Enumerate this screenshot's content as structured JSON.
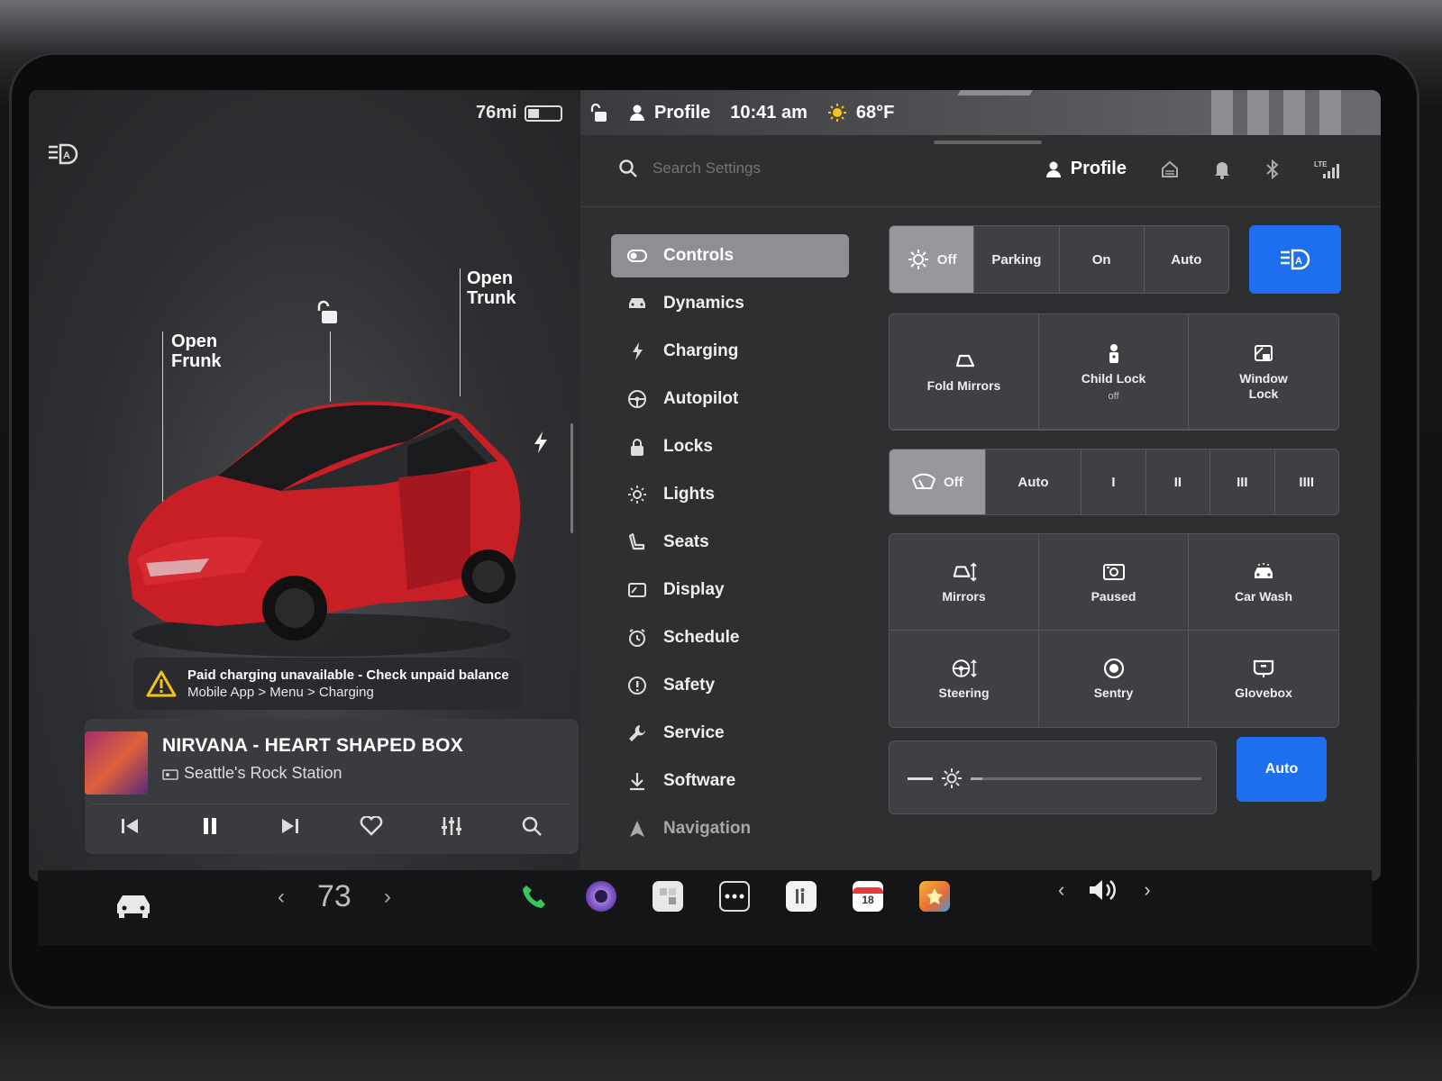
{
  "status": {
    "range": "76mi",
    "profile_label": "Profile",
    "time": "10:41 am",
    "temperature": "68°F"
  },
  "car_view": {
    "open_frunk_label": [
      "Open",
      "Frunk"
    ],
    "open_trunk_label": [
      "Open",
      "Trunk"
    ],
    "car_color": "#d2232a"
  },
  "alert": {
    "line1": "Paid charging unavailable - Check unpaid balance",
    "line2": "Mobile App > Menu > Charging"
  },
  "media": {
    "title": "NIRVANA - HEART SHAPED BOX",
    "station": "Seattle's Rock Station"
  },
  "settings": {
    "search_placeholder": "Search Settings",
    "profile_label": "Profile",
    "nav": [
      {
        "label": "Controls",
        "icon": "toggle-icon"
      },
      {
        "label": "Dynamics",
        "icon": "car-icon"
      },
      {
        "label": "Charging",
        "icon": "bolt-icon"
      },
      {
        "label": "Autopilot",
        "icon": "steering-wheel-icon"
      },
      {
        "label": "Locks",
        "icon": "lock-icon"
      },
      {
        "label": "Lights",
        "icon": "light-icon"
      },
      {
        "label": "Seats",
        "icon": "seat-icon"
      },
      {
        "label": "Display",
        "icon": "display-icon"
      },
      {
        "label": "Schedule",
        "icon": "alarm-icon"
      },
      {
        "label": "Safety",
        "icon": "info-icon"
      },
      {
        "label": "Service",
        "icon": "wrench-icon"
      },
      {
        "label": "Software",
        "icon": "download-icon"
      },
      {
        "label": "Navigation",
        "icon": "navigation-icon"
      }
    ],
    "headlights": {
      "options": [
        "Off",
        "Parking",
        "On",
        "Auto"
      ],
      "selected": "Off"
    },
    "mirror_tiles": {
      "fold_mirrors": "Fold Mirrors",
      "child_lock": "Child Lock",
      "child_lock_state": "off",
      "window_lock": [
        "Window",
        "Lock"
      ]
    },
    "wipers": {
      "options": [
        "Off",
        "Auto",
        "I",
        "II",
        "III",
        "IIII"
      ],
      "selected": "Off"
    },
    "adjust_tiles": {
      "mirrors": "Mirrors",
      "paused": "Paused",
      "car_wash": "Car Wash",
      "steering": "Steering",
      "sentry": "Sentry",
      "glovebox": "Glovebox"
    },
    "brightness_level": 0.05,
    "auto_button": "Auto"
  },
  "dock": {
    "temperature": "73",
    "calendar_day": "18"
  },
  "colors": {
    "accent_blue": "#1e6ff0",
    "phone_green": "#35c759"
  }
}
